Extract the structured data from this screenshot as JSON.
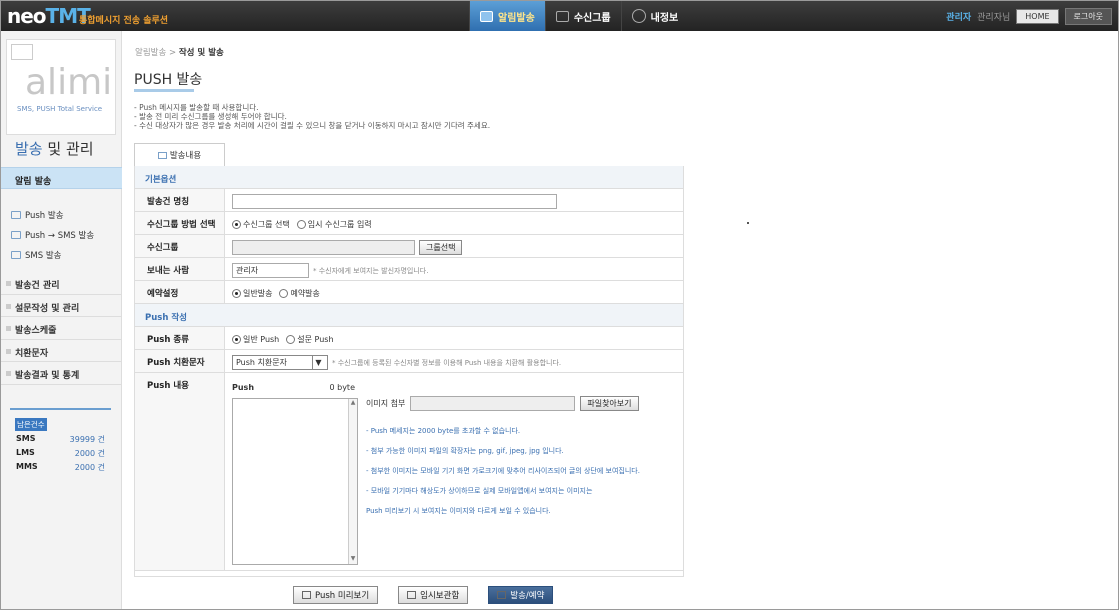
{
  "header": {
    "logo_main": "neo",
    "logo_accent": "TMT",
    "logo_sub": "통합메시지 전송 솔루션",
    "nav": [
      {
        "label": "알림발송",
        "icon": "send-icon",
        "active": true
      },
      {
        "label": "수신그룹",
        "icon": "group-icon",
        "active": false
      },
      {
        "label": "내정보",
        "icon": "user-icon",
        "active": false
      }
    ],
    "admin_label": "관리자",
    "admin_name": "관리자님",
    "home_label": "HOME",
    "logout_label": "로그아웃"
  },
  "sidebar": {
    "logo_text": "alimi",
    "logo_sub": "SMS, PUSH Total Service",
    "title_accent": "발송",
    "title_rest": "및 관리",
    "active_menu": "알림 발송",
    "sub_items": [
      "Push 발송",
      "Push → SMS 발송",
      "SMS 발송"
    ],
    "menus": [
      "발송건 관리",
      "설문작성 및 관리",
      "발송스케줄",
      "치환문자",
      "발송결과 및 통계"
    ],
    "stats_title": "남은건수",
    "stats": [
      {
        "label": "SMS",
        "value": "39999 건"
      },
      {
        "label": "LMS",
        "value": "2000 건"
      },
      {
        "label": "MMS",
        "value": "2000 건"
      }
    ]
  },
  "main": {
    "breadcrumb_parent": "알림발송 >",
    "breadcrumb_current": "작성 및 발송",
    "page_title": "PUSH 발송",
    "notes": [
      "- Push 메시지를 발송할 때 사용합니다.",
      "- 발송 전 미리 수신그룹를 생성해 두어야 합니다.",
      "- 수신 대상자가 많은 경우 발송 처리에 시간이 걸릴 수 있으니 창을 닫거나 이동하지 마시고 잠시만 기다려 주세요."
    ],
    "tab_label": "발송내용",
    "section_basic": "기본옵션",
    "section_push": "Push 작성",
    "fields": {
      "title_label": "발송건 명칭",
      "title_value": "",
      "group_method_label": "수신그룹 방법 선택",
      "group_method_options": [
        "수신그룹 선택",
        "임시 수신그룹 입력"
      ],
      "group_label": "수신그룹",
      "group_value": "",
      "group_button": "그룹선택",
      "sender_label": "보내는 사람",
      "sender_value": "관리자",
      "sender_hint": "* 수신자에게 보여지는 발신자명입니다.",
      "reserve_label": "예약설정",
      "reserve_options": [
        "일반발송",
        "예약발송"
      ],
      "push_type_label": "Push 종류",
      "push_type_options": [
        "일반 Push",
        "설문 Push"
      ],
      "subst_label": "Push 치환문자",
      "subst_value": "Push 치환문자",
      "subst_hint": "* 수신그룹에 등록된 수신자별 정보를 이용해 Push 내용을 치환해 활용합니다.",
      "content_label": "Push 내용",
      "push_area_label": "Push",
      "push_bytes": "0 byte",
      "attach_label": "이미지 첨부",
      "attach_button": "파일찾아보기",
      "push_notes": [
        "- Push 메세지는 2000 byte를 초과할 수 없습니다.",
        "- 첨부 가능한 이미지 파일의 확장자는 png, gif, jpeg, jpg 입니다.",
        "- 첨부한 이미지는 모바일 기기 화면 가로크기에 맞추어 리사이즈되어 글의 상단에 보여집니다.",
        "- 모바일 기기마다 해상도가 상이하므로 실제 모바일앱에서 보여지는 이미지는",
        "  Push 미리보기 시 보여지는 이미지와 다르게 보일 수 있습니다."
      ]
    },
    "buttons": {
      "preview": "Push 미리보기",
      "temp_save": "임시보관함",
      "send": "발송/예약"
    }
  }
}
